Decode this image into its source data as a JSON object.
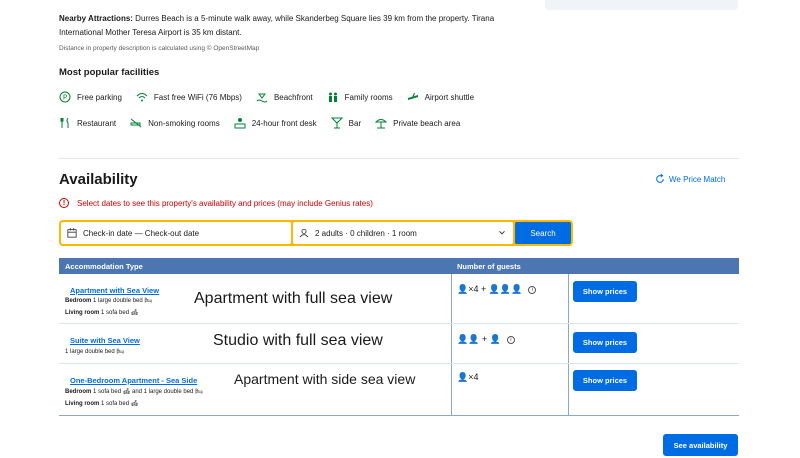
{
  "nearby": {
    "label": "Nearby Attractions:",
    "text": " Durres Beach is a 5-minute walk away, while Skanderbeg Square lies 39 km from the property. Tirana International Mother Teresa Airport is 35 km distant."
  },
  "distance_note": "Distance in property description is calculated using © OpenStreetMap",
  "facilities": {
    "title": "Most popular facilities",
    "row1": [
      {
        "label": "Free parking",
        "icon": "parking-icon"
      },
      {
        "label": "Fast free WiFi (76 Mbps)",
        "icon": "wifi-icon"
      },
      {
        "label": "Beachfront",
        "icon": "beach-icon"
      },
      {
        "label": "Family rooms",
        "icon": "family-icon"
      },
      {
        "label": "Airport shuttle",
        "icon": "shuttle-icon"
      }
    ],
    "row2": [
      {
        "label": "Restaurant",
        "icon": "restaurant-icon"
      },
      {
        "label": "Non-smoking rooms",
        "icon": "no-smoking-icon"
      },
      {
        "label": "24-hour front desk",
        "icon": "front-desk-icon"
      },
      {
        "label": "Bar",
        "icon": "bar-icon"
      },
      {
        "label": "Private beach area",
        "icon": "beach-umbrella-icon"
      }
    ],
    "icon_color": "#008234"
  },
  "availability": {
    "title": "Availability",
    "price_match": "We Price Match",
    "alert": "Select dates to see this property's availability and prices (may include Genius rates)",
    "alert_color": "#cc0000"
  },
  "search": {
    "dates": "Check-in date — Check-out date",
    "guests": "2 adults · 0 children · 1 room",
    "button": "Search",
    "border_color": "#ffb700",
    "button_color": "#006ce4"
  },
  "table": {
    "headers": {
      "type": "Accommodation Type",
      "guests": "Number of guests"
    },
    "header_color": "#4c76b2",
    "rows": [
      {
        "name": "Apartment with Sea View",
        "details": [
          {
            "label": "Bedroom",
            "text": " 1 large double bed 🛏"
          },
          {
            "label": "Living room",
            "text": " 1 sofa bed 🛋"
          }
        ],
        "overlay": "Apartment with full sea view",
        "guests": "👤×4 + 👤👤👤",
        "button": "Show prices"
      },
      {
        "name": "Suite with Sea View",
        "details": [
          {
            "label": "",
            "text": "1 large double bed 🛏"
          }
        ],
        "overlay": "Studio with full sea view",
        "guests": "👤👤 + 👤",
        "button": "Show prices"
      },
      {
        "name": "One-Bedroom Apartment - Sea Side",
        "details": [
          {
            "label": "Bedroom",
            "text": " 1 sofa bed 🛋 and 1 large double bed 🛏"
          },
          {
            "label": "Living room",
            "text": " 1 sofa bed 🛋"
          }
        ],
        "overlay": "Apartment with side sea view",
        "guests": "👤×4",
        "button": "Show prices"
      }
    ]
  },
  "see_availability": "See availability"
}
